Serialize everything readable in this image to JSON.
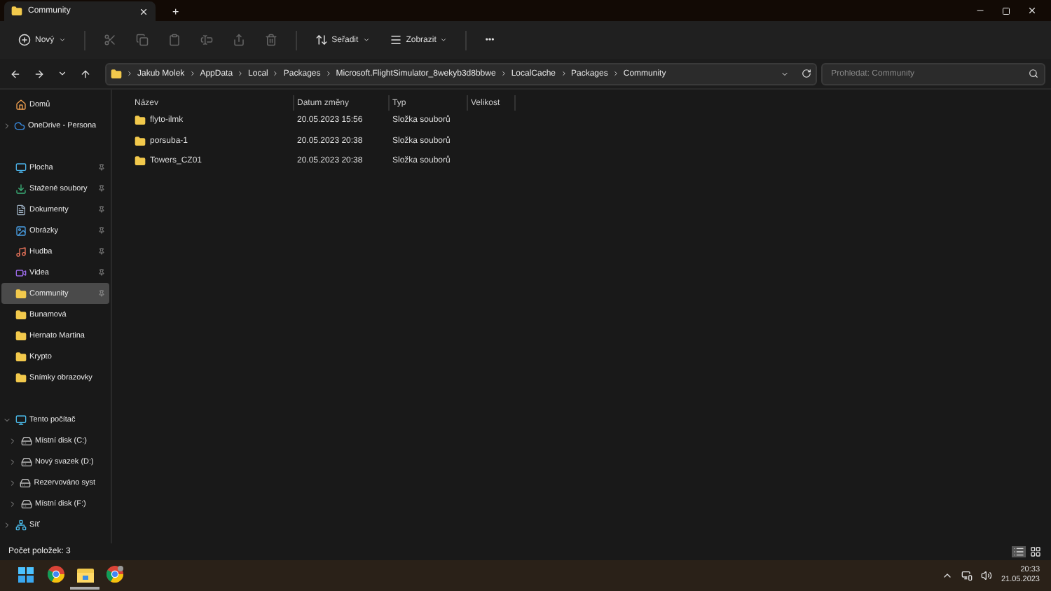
{
  "window": {
    "tab_title": "Community",
    "new_tab": "+"
  },
  "toolbar": {
    "new_label": "Nový",
    "actions": [
      {
        "kind": "cut",
        "disabled": true
      },
      {
        "kind": "copy",
        "disabled": true
      },
      {
        "kind": "paste",
        "disabled": true
      },
      {
        "kind": "rename",
        "disabled": true
      },
      {
        "kind": "share",
        "disabled": true
      },
      {
        "kind": "delete",
        "disabled": true
      }
    ],
    "sort_label": "Seřadit",
    "view_label": "Zobrazit",
    "more": "•••"
  },
  "address": {
    "crumbs": [
      "Jakub Molek",
      "AppData",
      "Local",
      "Packages",
      "Microsoft.FlightSimulator_8wekyb3d8bbwe",
      "LocalCache",
      "Packages",
      "Community"
    ]
  },
  "search": {
    "placeholder": "Prohledat: Community"
  },
  "sidebar": {
    "sections": [
      {
        "items": [
          {
            "label": "Domů",
            "kind": "home",
            "selected": false,
            "pinned": false
          },
          {
            "label": "OneDrive - Persona",
            "kind": "cloud",
            "selected": false,
            "pinned": false,
            "expanded": false
          }
        ]
      },
      {
        "items": [
          {
            "label": "Plocha",
            "kind": "desktop",
            "selected": false,
            "pinned": true
          },
          {
            "label": "Stažené soubory",
            "kind": "download",
            "selected": false,
            "pinned": true
          },
          {
            "label": "Dokumenty",
            "kind": "documents",
            "selected": false,
            "pinned": true
          },
          {
            "label": "Obrázky",
            "kind": "pictures",
            "selected": false,
            "pinned": true
          },
          {
            "label": "Hudba",
            "kind": "music",
            "selected": false,
            "pinned": true
          },
          {
            "label": "Videa",
            "kind": "videos",
            "selected": false,
            "pinned": true
          },
          {
            "label": "Community",
            "kind": "folder",
            "selected": true,
            "pinned": true
          },
          {
            "label": "Bunamová",
            "kind": "folder",
            "selected": false,
            "pinned": false
          },
          {
            "label": "Hernato Martina",
            "kind": "folder",
            "selected": false,
            "pinned": false
          },
          {
            "label": "Krypto",
            "kind": "folder",
            "selected": false,
            "pinned": false
          },
          {
            "label": "Snímky obrazovky",
            "kind": "folder",
            "selected": false,
            "pinned": false
          }
        ]
      },
      {
        "items": [
          {
            "label": "Tento počítač",
            "kind": "pc",
            "selected": false,
            "pinned": false,
            "expanded": true,
            "children": [
              {
                "label": "Místní disk (C:)",
                "kind": "drive",
                "selected": false,
                "pinned": false,
                "expanded": false
              },
              {
                "label": "Nový svazek (D:)",
                "kind": "drive",
                "selected": false,
                "pinned": false,
                "expanded": false
              },
              {
                "label": "Rezervováno syst",
                "kind": "drive",
                "selected": false,
                "pinned": false,
                "expanded": false
              },
              {
                "label": "Místní disk (F:)",
                "kind": "drive",
                "selected": false,
                "pinned": false,
                "expanded": false
              }
            ]
          },
          {
            "label": "Síť",
            "kind": "network",
            "selected": false,
            "pinned": false,
            "expanded": false
          }
        ]
      }
    ]
  },
  "table": {
    "columns": [
      "Název",
      "Datum změny",
      "Typ",
      "Velikost"
    ],
    "rows": [
      {
        "name": "flyto-ilmk",
        "date": "20.05.2023 15:56",
        "type": "Složka souborů"
      },
      {
        "name": "porsuba-1",
        "date": "20.05.2023 20:38",
        "type": "Složka souborů"
      },
      {
        "name": "Towers_CZ01",
        "date": "20.05.2023 20:38",
        "type": "Složka souborů"
      }
    ]
  },
  "status_bar": {
    "count": "Počet položek: 3",
    "view_buttons": [
      {
        "kind": "details",
        "selected": true
      },
      {
        "kind": "tiles",
        "selected": false
      }
    ]
  },
  "taskbar": {
    "apps": [
      {
        "kind": "start",
        "active": false
      },
      {
        "kind": "chrome",
        "active": false
      },
      {
        "kind": "explorer",
        "active": true
      },
      {
        "kind": "chrome-profile",
        "active": false
      }
    ],
    "time": "20:33",
    "date": "21.05.2023"
  }
}
